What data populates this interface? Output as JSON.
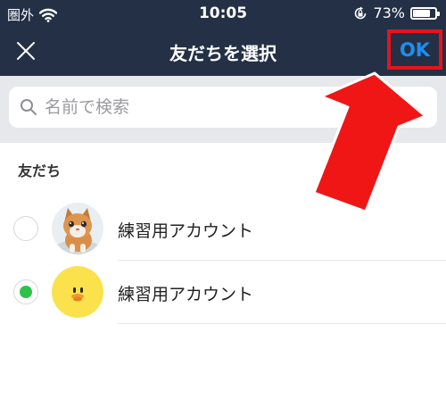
{
  "status_bar": {
    "carrier": "圏外",
    "time": "10:05",
    "battery_percent": "73%",
    "battery_level": 0.73
  },
  "nav": {
    "title": "友だちを選択",
    "ok_label": "OK"
  },
  "search": {
    "placeholder": "名前で検索"
  },
  "section": {
    "title": "友だち"
  },
  "friends": [
    {
      "name": "練習用アカウント",
      "selected": false
    },
    {
      "name": "練習用アカウント",
      "selected": true
    }
  ],
  "colors": {
    "header_bg": "#233046",
    "ok_text": "#1e8ff0",
    "highlight": "#e8121b",
    "radio_checked": "#2ec24a"
  }
}
